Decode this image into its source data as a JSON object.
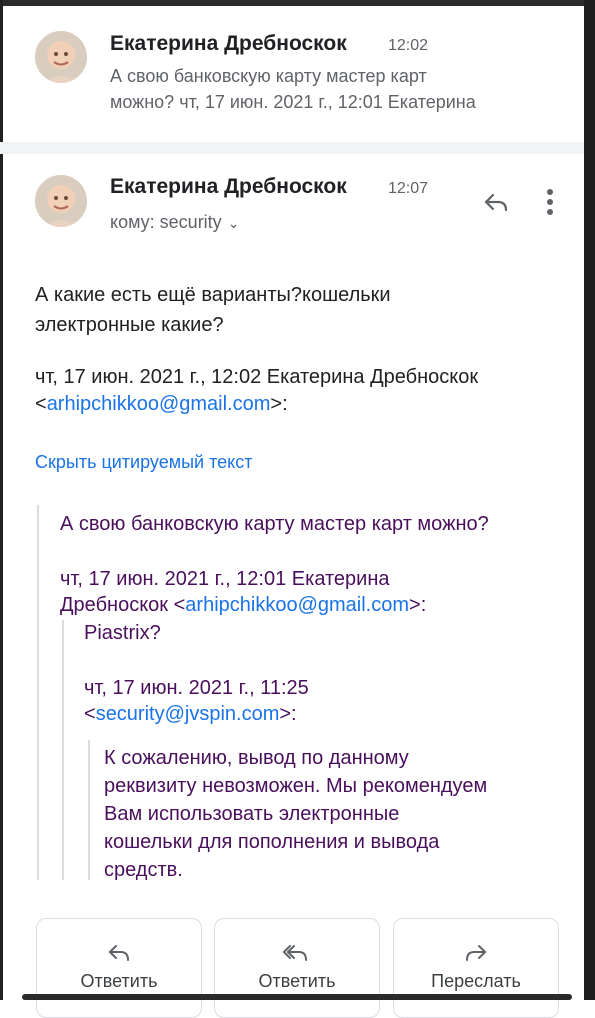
{
  "message_1": {
    "sender": "Екатерина Дребноскок",
    "time": "12:02",
    "snippet_line1": "А свою банковскую карту мастер карт",
    "snippet_line2": "можно? чт, 17 июн. 2021 г., 12:01 Екатерина"
  },
  "message_2": {
    "sender": "Екатерина Дребноскок",
    "time": "12:07",
    "to_label": "кому: security",
    "body_line1": "А какие есть ещё варианты?кошельки",
    "body_line2": "электронные какие?",
    "attribution_line1": "чт, 17 июн. 2021 г., 12:02 Екатерина Дребноскок",
    "attribution_email": "arhipchikkoo@gmail.com",
    "hide_quoted_text": "Скрыть цитируемый текст"
  },
  "quoted": {
    "level1_text": "А свою банковскую карту мастер карт можно?",
    "level1_attr_line1": "чт, 17 июн. 2021 г., 12:01 Екатерина",
    "level1_attr_name": "Дребноскок",
    "level1_attr_email": "arhipchikkoo@gmail.com",
    "level2_text": "Piastrix?",
    "level2_attr_line1": "чт, 17 июн. 2021 г., 11:25",
    "level2_attr_email": "security@jvspin.com",
    "level3_lines": [
      "К сожалению, вывод по данному",
      "реквизиту невозможен. Мы рекомендуем",
      "Вам использовать электронные",
      "кошельки для пополнения и вывода",
      "средств."
    ]
  },
  "actions": {
    "reply": "Ответить",
    "reply_all": "Ответить",
    "forward": "Переслать"
  },
  "icons": {
    "reply": "reply-icon",
    "reply_all": "reply-all-icon",
    "forward": "forward-icon",
    "more": "more-vertical-icon",
    "chevron": "chevron-down-icon"
  }
}
